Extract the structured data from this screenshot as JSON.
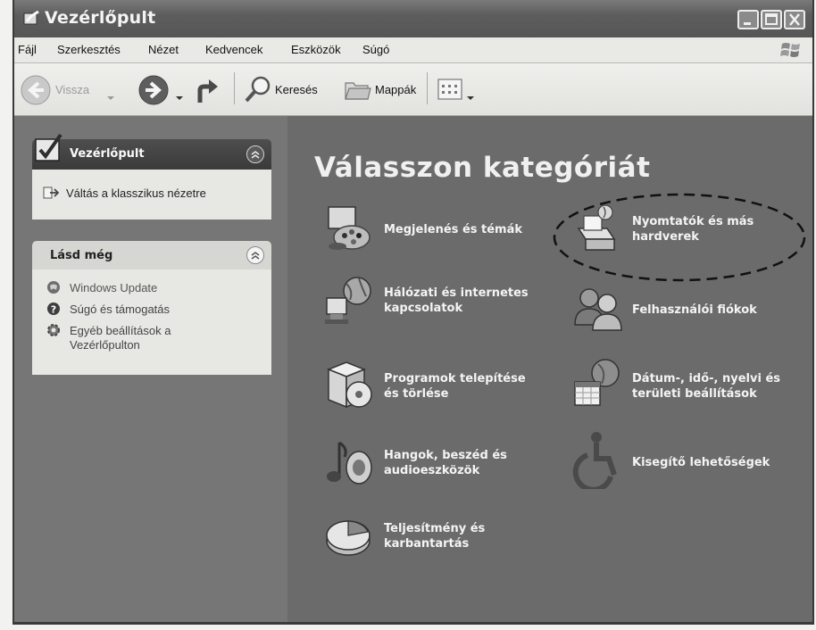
{
  "window": {
    "title": "Vezérlőpult"
  },
  "menubar": {
    "items": [
      "Fájl",
      "Szerkesztés",
      "Nézet",
      "Kedvencek",
      "Eszközök",
      "Súgó"
    ]
  },
  "toolbar": {
    "back_label": "Vissza",
    "search_label": "Keresés",
    "folders_label": "Mappák"
  },
  "leftpane": {
    "control_panel": {
      "title": "Vezérlőpult",
      "switch_link": "Váltás a klasszikus nézetre"
    },
    "see_also": {
      "title": "Lásd még",
      "links": [
        "Windows Update",
        "Súgó és támogatás",
        "Egyéb beállítások a",
        "Vezérlőpulton"
      ]
    }
  },
  "main": {
    "heading": "Válasszon kategóriát",
    "categories": [
      {
        "label": "Megjelenés és témák",
        "icon": "appearance-icon"
      },
      {
        "label": "Nyomtatók és más",
        "label2": "hardverek",
        "icon": "printer-icon"
      },
      {
        "label": "Hálózati és internetes",
        "label2": "kapcsolatok",
        "icon": "network-icon"
      },
      {
        "label": "Felhasználói fiókok",
        "icon": "user-accounts-icon"
      },
      {
        "label": "Programok telepítése",
        "label2": "és törlése",
        "icon": "add-remove-programs-icon"
      },
      {
        "label": "Dátum-, idő-, nyelvi és",
        "label2": "területi beállítások",
        "icon": "date-time-icon"
      },
      {
        "label": "Hangok, beszéd és",
        "label2": "audioeszközök",
        "icon": "sounds-icon"
      },
      {
        "label": "Kisegítő lehetőségek",
        "icon": "accessibility-icon"
      },
      {
        "label": "Teljesítmény és",
        "label2": "karbantartás",
        "icon": "performance-icon"
      }
    ]
  },
  "colors": {
    "title_bar": "#5d5d5d",
    "main_background": "#6b6b6b",
    "panel_background": "#e7e7e4"
  }
}
